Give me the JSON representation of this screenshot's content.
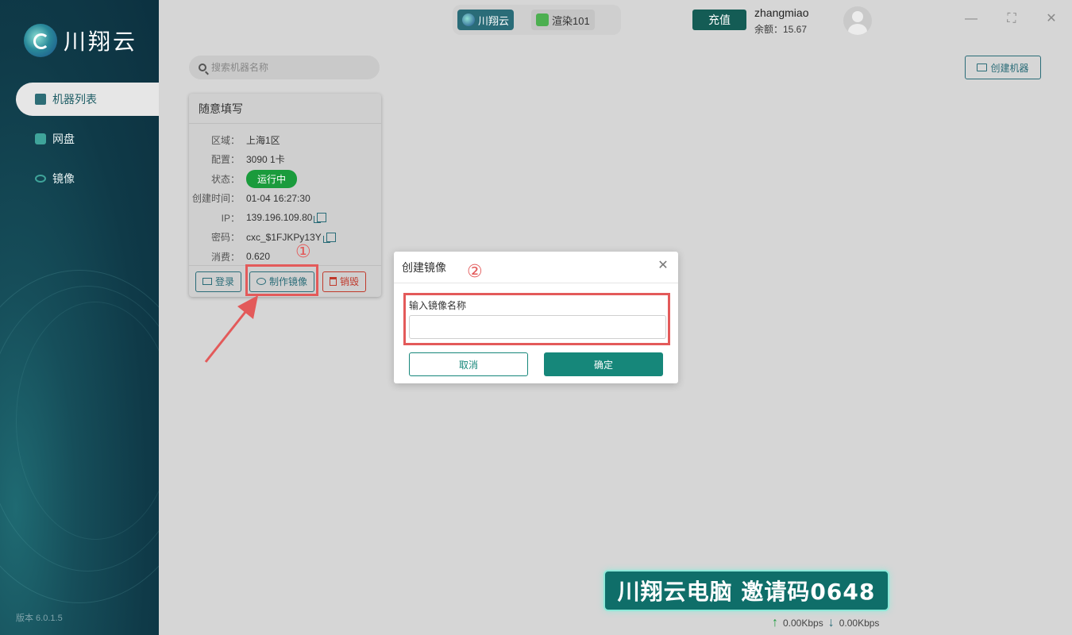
{
  "app": {
    "logo_text": "川翔云",
    "version": "版本 6.0.1.5"
  },
  "sidebar": {
    "items": [
      {
        "label": "机器列表",
        "icon": "server-list-icon",
        "active": true
      },
      {
        "label": "网盘",
        "icon": "cloud-disk-icon",
        "active": false
      },
      {
        "label": "镜像",
        "icon": "image-eye-icon",
        "active": false
      }
    ]
  },
  "topbar": {
    "tabs": [
      {
        "label": "川翔云",
        "active": true
      },
      {
        "label": "渲染101",
        "active": false
      }
    ],
    "recharge_label": "充值",
    "username": "zhangmiao",
    "balance": "余额：15.67"
  },
  "search": {
    "placeholder": "搜索机器名称"
  },
  "create_machine_label": "创建机器",
  "machine_card": {
    "title": "随意填写",
    "fields": [
      {
        "key": "区域：",
        "value": "上海1区"
      },
      {
        "key": "配置：",
        "value": "3090 1卡"
      },
      {
        "key": "状态：",
        "value": "运行中"
      },
      {
        "key": "创建时间：",
        "value": "01-04 16:27:30"
      },
      {
        "key": "IP：",
        "value": "139.196.109.80"
      },
      {
        "key": "密码：",
        "value": "cxc_$1FJKPy13Y"
      },
      {
        "key": "消费：",
        "value": "0.620"
      }
    ],
    "actions": {
      "login": "登录",
      "make_image": "制作镜像",
      "destroy": "销毁"
    }
  },
  "annotations": {
    "step1": "①",
    "step2": "②"
  },
  "dialog": {
    "title": "创建镜像",
    "field_label": "输入镜像名称",
    "input_value": "",
    "cancel_label": "取消",
    "ok_label": "确定"
  },
  "banner": {
    "text": "川翔云电脑 邀请码0648"
  },
  "network": {
    "upload": "0.00Kbps",
    "download": "0.00Kbps"
  },
  "colors": {
    "accent": "#16877a",
    "sidebar": "#0f3a48",
    "status_running": "#1a9b3c",
    "danger": "#c0392b",
    "annotation": "#e35a5a"
  }
}
